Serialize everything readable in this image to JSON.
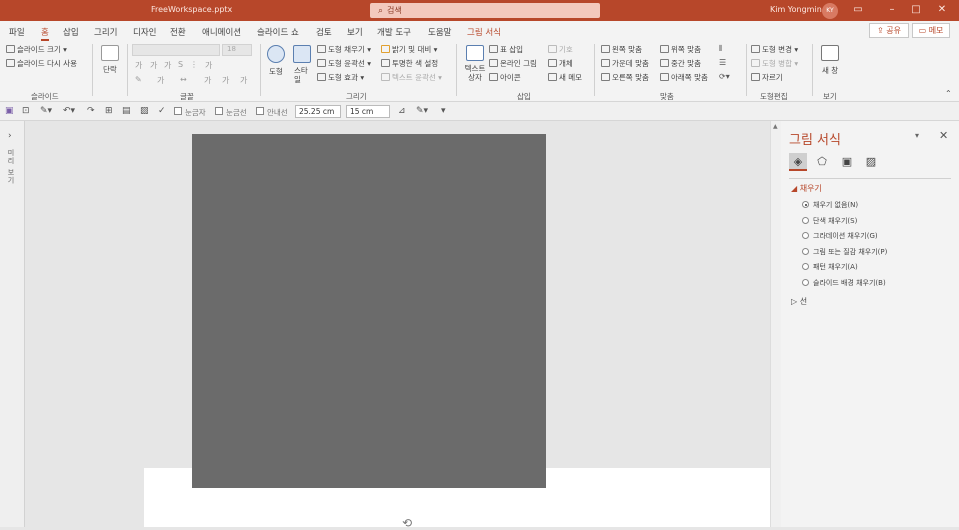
{
  "window": {
    "filename": "FreeWorkspace.pptx",
    "search_placeholder": "검색",
    "user_name": "Kim Yongmin",
    "user_initials": "KY"
  },
  "tabs": [
    "파일",
    "홈",
    "삽입",
    "그리기",
    "디자인",
    "전환",
    "애니메이션",
    "슬라이드 쇼",
    "검토",
    "보기",
    "개발 도구",
    "도움말",
    "그림 서식"
  ],
  "active_tab": "홈",
  "actions": {
    "share": "공유",
    "memo": "메모"
  },
  "ribbon": {
    "slide": {
      "new_size": "슬라이드 크기",
      "reuse": "슬라이드 다시 사용",
      "group": "슬라이드"
    },
    "paragraph": {
      "label": "단락"
    },
    "font": {
      "size": "18",
      "group": "글꼴"
    },
    "drawing": {
      "shapes": "도형",
      "styles": "스타일",
      "fill": "도형 채우기",
      "outline": "도형 윤곽선",
      "effects": "도형 효과",
      "brightness": "밝기 및 대비",
      "transparent": "투명한 색 설정",
      "text_outline": "텍스트 윤곽선",
      "group": "그리기"
    },
    "insert": {
      "textbox": "텍스트 상자",
      "table": "표 삽입",
      "online_pic": "온라인 그림",
      "icons": "아이콘",
      "symbol": "기호",
      "object": "개체",
      "new_memo": "새 메모",
      "group": "삽입"
    },
    "arrange": {
      "left": "왼쪽 맞춤",
      "center": "가운데 맞춤",
      "right": "오른쪽 맞춤",
      "top": "위쪽 맞춤",
      "middle": "중간 맞춤",
      "bottom": "아래쪽 맞춤",
      "group": "맞춤"
    },
    "shapeedit": {
      "change": "도형 변경",
      "merge": "도형 병합",
      "crop": "자르기",
      "group": "도형편집"
    },
    "view": {
      "window": "새 창",
      "group": "보기"
    }
  },
  "qat": {
    "ruler": "눈금자",
    "grid": "눈금선",
    "guides": "안내선",
    "width": "25.25 cm",
    "height": "15 cm"
  },
  "left_pane": {
    "label": "미리 보기"
  },
  "format_pane": {
    "title": "그림 서식",
    "fill_header": "채우기",
    "fill_options": [
      {
        "label": "채우기 없음(N)",
        "selected": true
      },
      {
        "label": "단색 채우기(S)",
        "selected": false
      },
      {
        "label": "그라데이션 채우기(G)",
        "selected": false
      },
      {
        "label": "그림 또는 질감 채우기(P)",
        "selected": false
      },
      {
        "label": "패턴 채우기(A)",
        "selected": false
      },
      {
        "label": "슬라이드 배경 채우기(B)",
        "selected": false
      }
    ],
    "line_header": "선"
  },
  "colors": {
    "accent": "#b7472a",
    "picture": "#6b6b6b"
  }
}
